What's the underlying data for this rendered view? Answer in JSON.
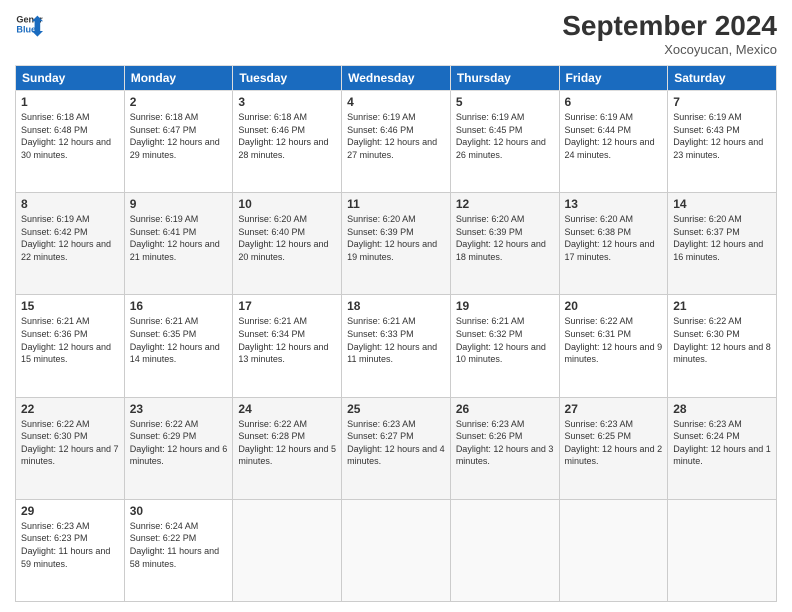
{
  "header": {
    "logo": {
      "line1": "General",
      "line2": "Blue"
    },
    "title": "September 2024",
    "location": "Xocoyucan, Mexico"
  },
  "weekdays": [
    "Sunday",
    "Monday",
    "Tuesday",
    "Wednesday",
    "Thursday",
    "Friday",
    "Saturday"
  ],
  "weeks": [
    [
      {
        "day": "1",
        "sunrise": "6:18 AM",
        "sunset": "6:48 PM",
        "daylight": "12 hours and 30 minutes."
      },
      {
        "day": "2",
        "sunrise": "6:18 AM",
        "sunset": "6:47 PM",
        "daylight": "12 hours and 29 minutes."
      },
      {
        "day": "3",
        "sunrise": "6:18 AM",
        "sunset": "6:46 PM",
        "daylight": "12 hours and 28 minutes."
      },
      {
        "day": "4",
        "sunrise": "6:19 AM",
        "sunset": "6:46 PM",
        "daylight": "12 hours and 27 minutes."
      },
      {
        "day": "5",
        "sunrise": "6:19 AM",
        "sunset": "6:45 PM",
        "daylight": "12 hours and 26 minutes."
      },
      {
        "day": "6",
        "sunrise": "6:19 AM",
        "sunset": "6:44 PM",
        "daylight": "12 hours and 24 minutes."
      },
      {
        "day": "7",
        "sunrise": "6:19 AM",
        "sunset": "6:43 PM",
        "daylight": "12 hours and 23 minutes."
      }
    ],
    [
      {
        "day": "8",
        "sunrise": "6:19 AM",
        "sunset": "6:42 PM",
        "daylight": "12 hours and 22 minutes."
      },
      {
        "day": "9",
        "sunrise": "6:19 AM",
        "sunset": "6:41 PM",
        "daylight": "12 hours and 21 minutes."
      },
      {
        "day": "10",
        "sunrise": "6:20 AM",
        "sunset": "6:40 PM",
        "daylight": "12 hours and 20 minutes."
      },
      {
        "day": "11",
        "sunrise": "6:20 AM",
        "sunset": "6:39 PM",
        "daylight": "12 hours and 19 minutes."
      },
      {
        "day": "12",
        "sunrise": "6:20 AM",
        "sunset": "6:39 PM",
        "daylight": "12 hours and 18 minutes."
      },
      {
        "day": "13",
        "sunrise": "6:20 AM",
        "sunset": "6:38 PM",
        "daylight": "12 hours and 17 minutes."
      },
      {
        "day": "14",
        "sunrise": "6:20 AM",
        "sunset": "6:37 PM",
        "daylight": "12 hours and 16 minutes."
      }
    ],
    [
      {
        "day": "15",
        "sunrise": "6:21 AM",
        "sunset": "6:36 PM",
        "daylight": "12 hours and 15 minutes."
      },
      {
        "day": "16",
        "sunrise": "6:21 AM",
        "sunset": "6:35 PM",
        "daylight": "12 hours and 14 minutes."
      },
      {
        "day": "17",
        "sunrise": "6:21 AM",
        "sunset": "6:34 PM",
        "daylight": "12 hours and 13 minutes."
      },
      {
        "day": "18",
        "sunrise": "6:21 AM",
        "sunset": "6:33 PM",
        "daylight": "12 hours and 11 minutes."
      },
      {
        "day": "19",
        "sunrise": "6:21 AM",
        "sunset": "6:32 PM",
        "daylight": "12 hours and 10 minutes."
      },
      {
        "day": "20",
        "sunrise": "6:22 AM",
        "sunset": "6:31 PM",
        "daylight": "12 hours and 9 minutes."
      },
      {
        "day": "21",
        "sunrise": "6:22 AM",
        "sunset": "6:30 PM",
        "daylight": "12 hours and 8 minutes."
      }
    ],
    [
      {
        "day": "22",
        "sunrise": "6:22 AM",
        "sunset": "6:30 PM",
        "daylight": "12 hours and 7 minutes."
      },
      {
        "day": "23",
        "sunrise": "6:22 AM",
        "sunset": "6:29 PM",
        "daylight": "12 hours and 6 minutes."
      },
      {
        "day": "24",
        "sunrise": "6:22 AM",
        "sunset": "6:28 PM",
        "daylight": "12 hours and 5 minutes."
      },
      {
        "day": "25",
        "sunrise": "6:23 AM",
        "sunset": "6:27 PM",
        "daylight": "12 hours and 4 minutes."
      },
      {
        "day": "26",
        "sunrise": "6:23 AM",
        "sunset": "6:26 PM",
        "daylight": "12 hours and 3 minutes."
      },
      {
        "day": "27",
        "sunrise": "6:23 AM",
        "sunset": "6:25 PM",
        "daylight": "12 hours and 2 minutes."
      },
      {
        "day": "28",
        "sunrise": "6:23 AM",
        "sunset": "6:24 PM",
        "daylight": "12 hours and 1 minute."
      }
    ],
    [
      {
        "day": "29",
        "sunrise": "6:23 AM",
        "sunset": "6:23 PM",
        "daylight": "11 hours and 59 minutes."
      },
      {
        "day": "30",
        "sunrise": "6:24 AM",
        "sunset": "6:22 PM",
        "daylight": "11 hours and 58 minutes."
      },
      null,
      null,
      null,
      null,
      null
    ]
  ]
}
